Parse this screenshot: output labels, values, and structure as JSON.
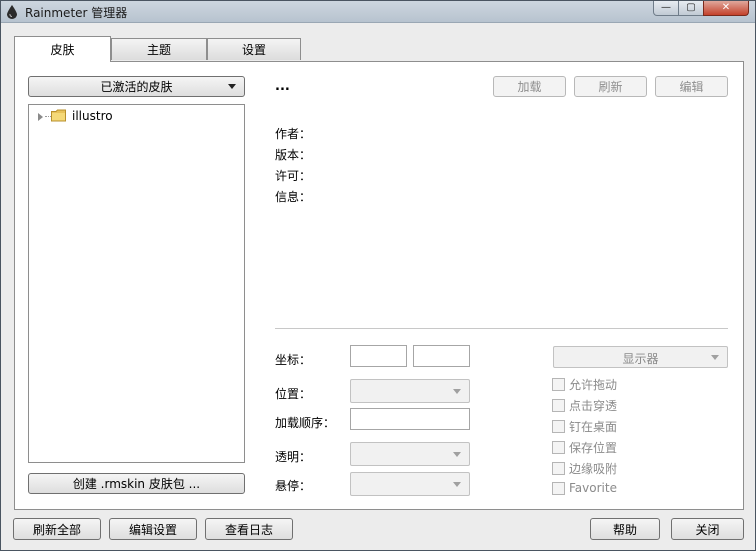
{
  "window": {
    "title": "Rainmeter 管理器"
  },
  "window_controls": {
    "minimize": "—",
    "maximize": "▢",
    "close": "✕"
  },
  "tabs": [
    {
      "label": "皮肤",
      "active": true
    },
    {
      "label": "主题",
      "active": false
    },
    {
      "label": "设置",
      "active": false
    }
  ],
  "skins": {
    "active_dropdown": "已激活的皮肤",
    "tree": [
      {
        "label": "illustro",
        "icon": "folder-icon",
        "expanded": false
      }
    ],
    "create_button": "创建 .rmskin 皮肤包 ..."
  },
  "details": {
    "title": "...",
    "buttons": {
      "load": "加载",
      "refresh": "刷新",
      "edit": "编辑"
    },
    "labels": {
      "author": "作者：",
      "version": "版本：",
      "license": "许可：",
      "info": "信息："
    }
  },
  "settings": {
    "coordinates_label": "坐标：",
    "position_label": "位置：",
    "load_order_label": "加载顺序：",
    "transparency_label": "透明：",
    "hover_label": "悬停：",
    "display_dropdown": "显示器",
    "checkboxes": [
      {
        "label": "允许拖动",
        "checked": false
      },
      {
        "label": "点击穿透",
        "checked": false
      },
      {
        "label": "钉在桌面",
        "checked": false
      },
      {
        "label": "保存位置",
        "checked": false
      },
      {
        "label": "边缘吸附",
        "checked": false
      },
      {
        "label": "Favorite",
        "checked": false
      }
    ]
  },
  "footer": {
    "refresh_all": "刷新全部",
    "edit_settings": "编辑设置",
    "view_log": "查看日志",
    "help": "帮助",
    "close": "关闭"
  }
}
